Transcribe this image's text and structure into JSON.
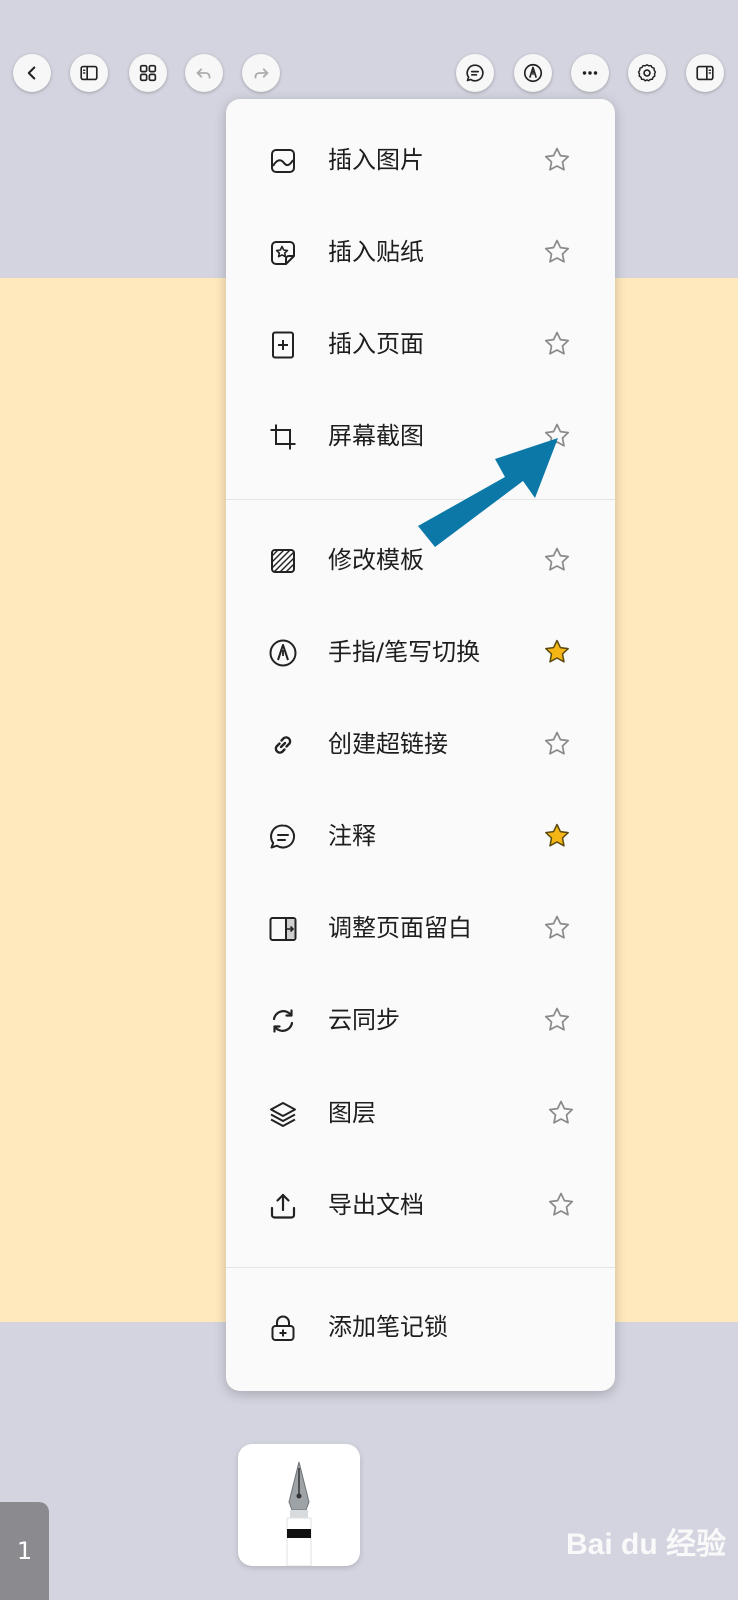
{
  "toolbar": {
    "left_buttons": [
      "back-icon",
      "sidebar-icon",
      "grid-icon",
      "undo-icon",
      "redo-icon"
    ],
    "right_buttons": [
      "comment-icon",
      "pen-mode-icon",
      "more-icon",
      "settings-icon",
      "panel-icon"
    ]
  },
  "menu": {
    "items": [
      {
        "label": "插入图片",
        "icon": "image-icon",
        "starred": false
      },
      {
        "label": "插入贴纸",
        "icon": "sticker-icon",
        "starred": false
      },
      {
        "label": "插入页面",
        "icon": "add-page-icon",
        "starred": false
      },
      {
        "label": "屏幕截图",
        "icon": "crop-icon",
        "starred": false
      },
      {
        "label": "修改模板",
        "icon": "template-icon",
        "starred": false
      },
      {
        "label": "手指/笔写切换",
        "icon": "pen-nib-icon",
        "starred": true
      },
      {
        "label": "创建超链接",
        "icon": "link-icon",
        "starred": false
      },
      {
        "label": "注释",
        "icon": "comment-icon",
        "starred": true
      },
      {
        "label": "调整页面留白",
        "icon": "page-margin-icon",
        "starred": false
      },
      {
        "label": "云同步",
        "icon": "sync-icon",
        "starred": false
      },
      {
        "label": "图层",
        "icon": "layers-icon",
        "starred": false
      },
      {
        "label": "导出文档",
        "icon": "export-icon",
        "starred": false
      },
      {
        "label": "添加笔记锁",
        "icon": "lock-icon",
        "starred": null
      }
    ]
  },
  "colors": {
    "star_active": "#f5b514",
    "arrow": "#0b78a8",
    "paper": "#ffe9bd",
    "background": "#d3d4df"
  },
  "page_indicator": "1",
  "watermark": "Bai du 经验"
}
